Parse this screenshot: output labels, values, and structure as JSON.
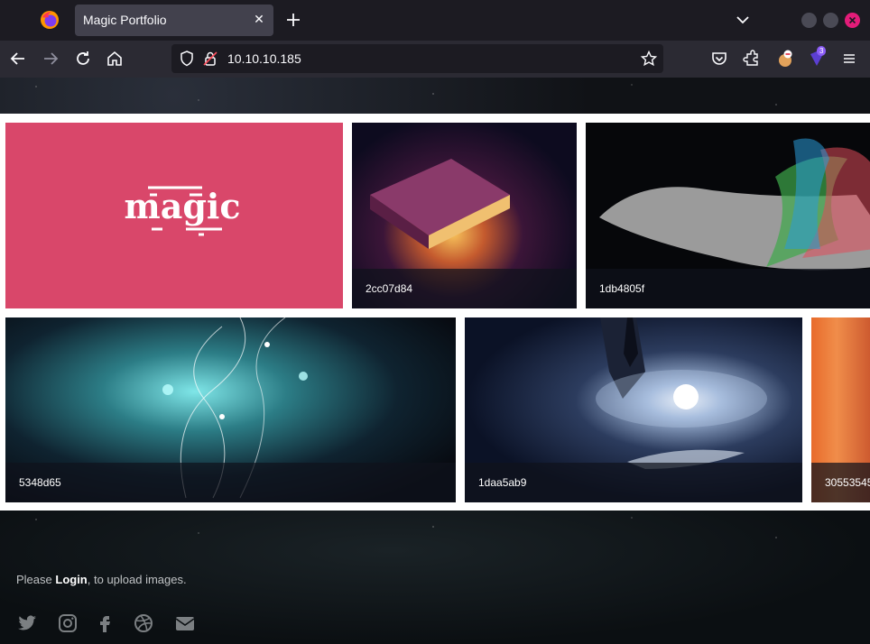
{
  "browser": {
    "tab_title": "Magic Portfolio",
    "url": "10.10.10.185",
    "extension_badge": "3"
  },
  "gallery": {
    "tiles": [
      {
        "caption": ""
      },
      {
        "caption": "2cc07d84"
      },
      {
        "caption": "1db4805f"
      },
      {
        "caption": "5348d65"
      },
      {
        "caption": "1daa5ab9"
      },
      {
        "caption": "30553545"
      }
    ],
    "logo_text": "magic"
  },
  "footer": {
    "text_before": "Please ",
    "login_link": "Login",
    "text_after": ", to upload images."
  },
  "colors": {
    "tile_pink": "#d9476a",
    "close_button": "#e31c79"
  },
  "icons": [
    "firefox-icon",
    "back-icon",
    "forward-icon",
    "reload-icon",
    "home-icon",
    "shield-icon",
    "lock-icon",
    "star-icon",
    "pocket-icon",
    "extensions-icon",
    "menu-icon",
    "twitter-icon",
    "instagram-icon",
    "facebook-icon",
    "dribbble-icon",
    "envelope-icon"
  ]
}
